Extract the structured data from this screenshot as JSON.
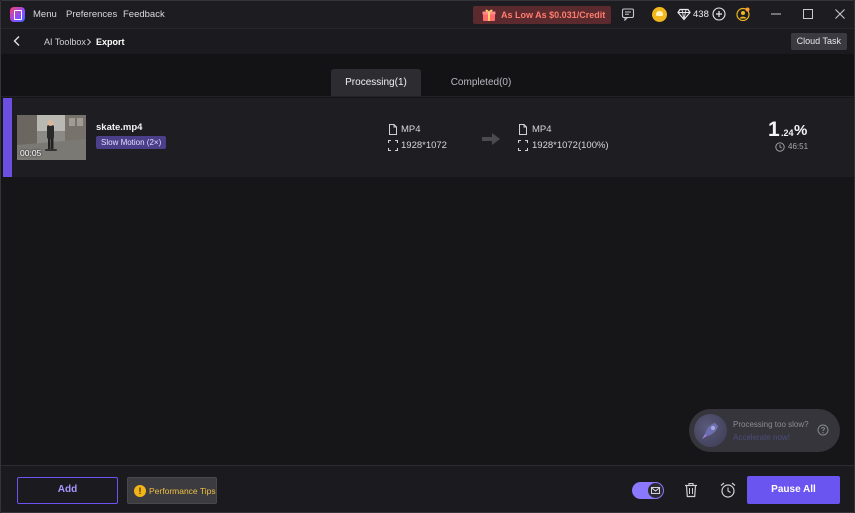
{
  "titlebar": {
    "menu_items": [
      "Menu",
      "Preferences",
      "Feedback"
    ],
    "promo_text": "As Low As $0.031/Credit",
    "credits": "438"
  },
  "breadcrumb": {
    "items": [
      "AI Toolbox",
      "Export"
    ],
    "cloud_task_label": "Cloud Task"
  },
  "tabs": [
    {
      "label": "Processing(1)",
      "active": true
    },
    {
      "label": "Completed(0)",
      "active": false
    }
  ],
  "task": {
    "file_name": "skate.mp4",
    "duration": "00:05",
    "effect": "Slow Motion (2×)",
    "source_format": "MP4",
    "source_resolution": "1928*1072",
    "output_format": "MP4",
    "output_resolution": "1928*1072(100%)",
    "percent_main": "1",
    "percent_decimal": ".24",
    "percent_sign": "%",
    "time_remaining": "46:51"
  },
  "accelerate": {
    "title": "Processing too slow?",
    "link": "Accelerate now!"
  },
  "bottom": {
    "add_label": "Add",
    "performance_tips_label": "Performance Tips",
    "pause_all_label": "Pause All",
    "notify_enabled": true
  },
  "colors": {
    "accent": "#6b55f0",
    "warning": "#f3b515",
    "promo": "#ff7d6e"
  }
}
